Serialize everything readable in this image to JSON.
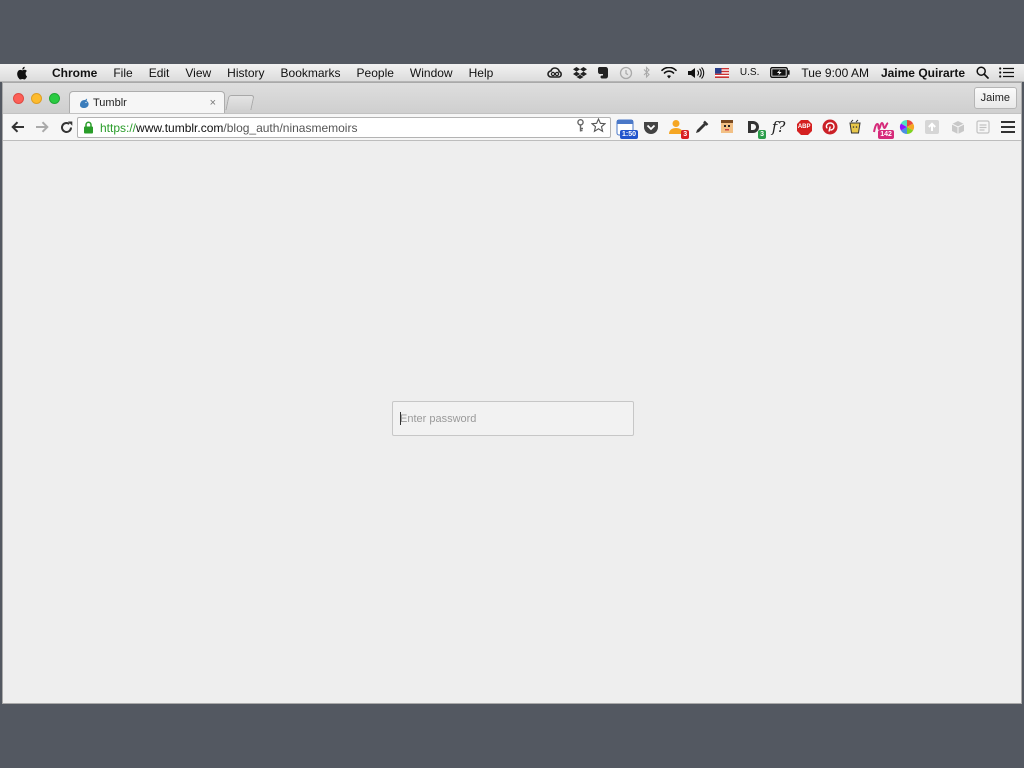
{
  "menubar": {
    "app_name": "Chrome",
    "items": [
      "File",
      "Edit",
      "View",
      "History",
      "Bookmarks",
      "People",
      "Window",
      "Help"
    ],
    "status": {
      "input_source": "U.S.",
      "clock": "Tue 9:00 AM",
      "user": "Jaime Quirarte"
    }
  },
  "browser": {
    "tab": {
      "title": "Tumblr",
      "close_glyph": "×"
    },
    "profile_button": "Jaime",
    "address": {
      "scheme": "https://",
      "host": "www.tumblr.com",
      "path": "/blog_auth/ninasmemoirs"
    },
    "extensions": [
      {
        "icon": "calendar-icon",
        "badge": "1:50",
        "badge_color": "#2255cc"
      },
      {
        "icon": "pocket-icon"
      },
      {
        "icon": "people-icon",
        "badge": "3",
        "badge_color": "#d92020"
      },
      {
        "icon": "eyedropper-icon"
      },
      {
        "icon": "face-icon"
      },
      {
        "icon": "d-extension-icon",
        "badge": "3",
        "badge_color": "#2a9d4a"
      },
      {
        "icon": "whatfont-icon",
        "label": "f?"
      },
      {
        "icon": "adblock-icon",
        "label": "ABP"
      },
      {
        "icon": "pinterest-icon"
      },
      {
        "icon": "cup-icon"
      },
      {
        "icon": "m-extension-icon",
        "badge": "142",
        "badge_color": "#d62a7a"
      },
      {
        "icon": "color-wheel-icon"
      },
      {
        "icon": "upload-icon"
      },
      {
        "icon": "box-icon"
      },
      {
        "icon": "list-icon"
      }
    ]
  },
  "page": {
    "password_placeholder": "Enter password",
    "password_value": ""
  },
  "colors": {
    "desktop": "#535861",
    "secure_scheme": "#2a9d2a",
    "page_bg": "#eeeeee"
  }
}
